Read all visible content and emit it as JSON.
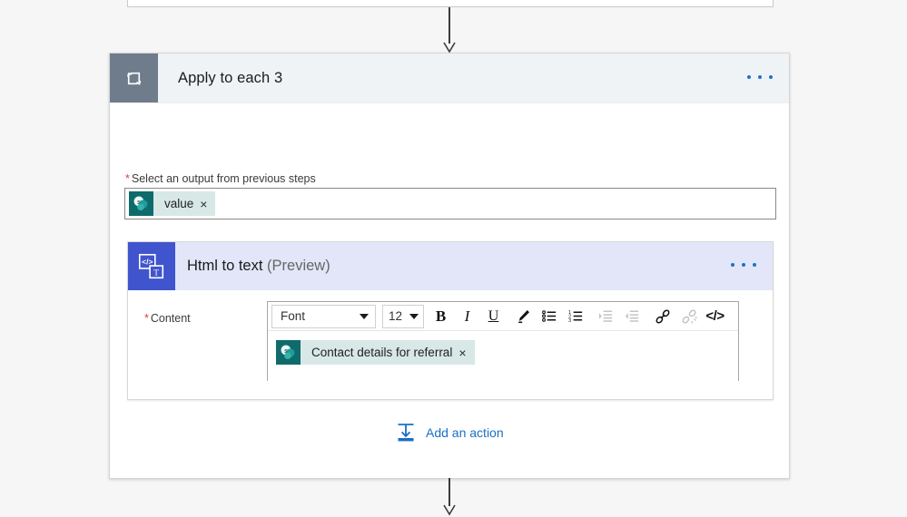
{
  "scope": {
    "icon": "loop-icon",
    "title": "Apply to each 3",
    "menu": "more-commands",
    "field": {
      "required_mark": "*",
      "label": "Select an output from previous steps",
      "token": {
        "icon": "sharepoint-icon",
        "text": "value",
        "remove": "×"
      }
    }
  },
  "action": {
    "icon": "html-to-text-icon",
    "title": "Html to text",
    "preview_suffix": "(Preview)",
    "menu": "more-commands",
    "content": {
      "required_mark": "*",
      "label": "Content",
      "token": {
        "icon": "sharepoint-icon",
        "text": "Contact details for referral",
        "remove": "×"
      }
    },
    "toolbar": {
      "font_value": "Font",
      "size_value": "12",
      "bold": "B",
      "italic": "I",
      "underline": "U",
      "buttons": [
        {
          "name": "highlighter-icon",
          "label": "Text highlight color",
          "disabled": false
        },
        {
          "name": "bulleted-list-icon",
          "label": "Bulleted list",
          "disabled": false
        },
        {
          "name": "numbered-list-icon",
          "label": "Numbered list",
          "disabled": false
        },
        {
          "name": "increase-indent-icon",
          "label": "Increase indent",
          "disabled": true
        },
        {
          "name": "decrease-indent-icon",
          "label": "Decrease indent",
          "disabled": true
        },
        {
          "name": "link-icon",
          "label": "Insert link",
          "disabled": false
        },
        {
          "name": "unlink-icon",
          "label": "Remove link",
          "disabled": true
        }
      ],
      "code_view": "</>"
    }
  },
  "add_action": {
    "icon": "add-an-action-icon",
    "label": "Add an action"
  },
  "colors": {
    "page_background": "#f6f6f6",
    "scope_header": "#eff3f6",
    "scope_icon": "#6f7c8c",
    "action_header": "#e2e6f8",
    "action_icon": "#4054cd",
    "token_background": "#d7e8e7",
    "sharepoint_icon": "#0f6b6b",
    "accent_link": "#1a73c7",
    "required_asterisk": "#e23b3b",
    "connector": "#3b3b3b"
  }
}
